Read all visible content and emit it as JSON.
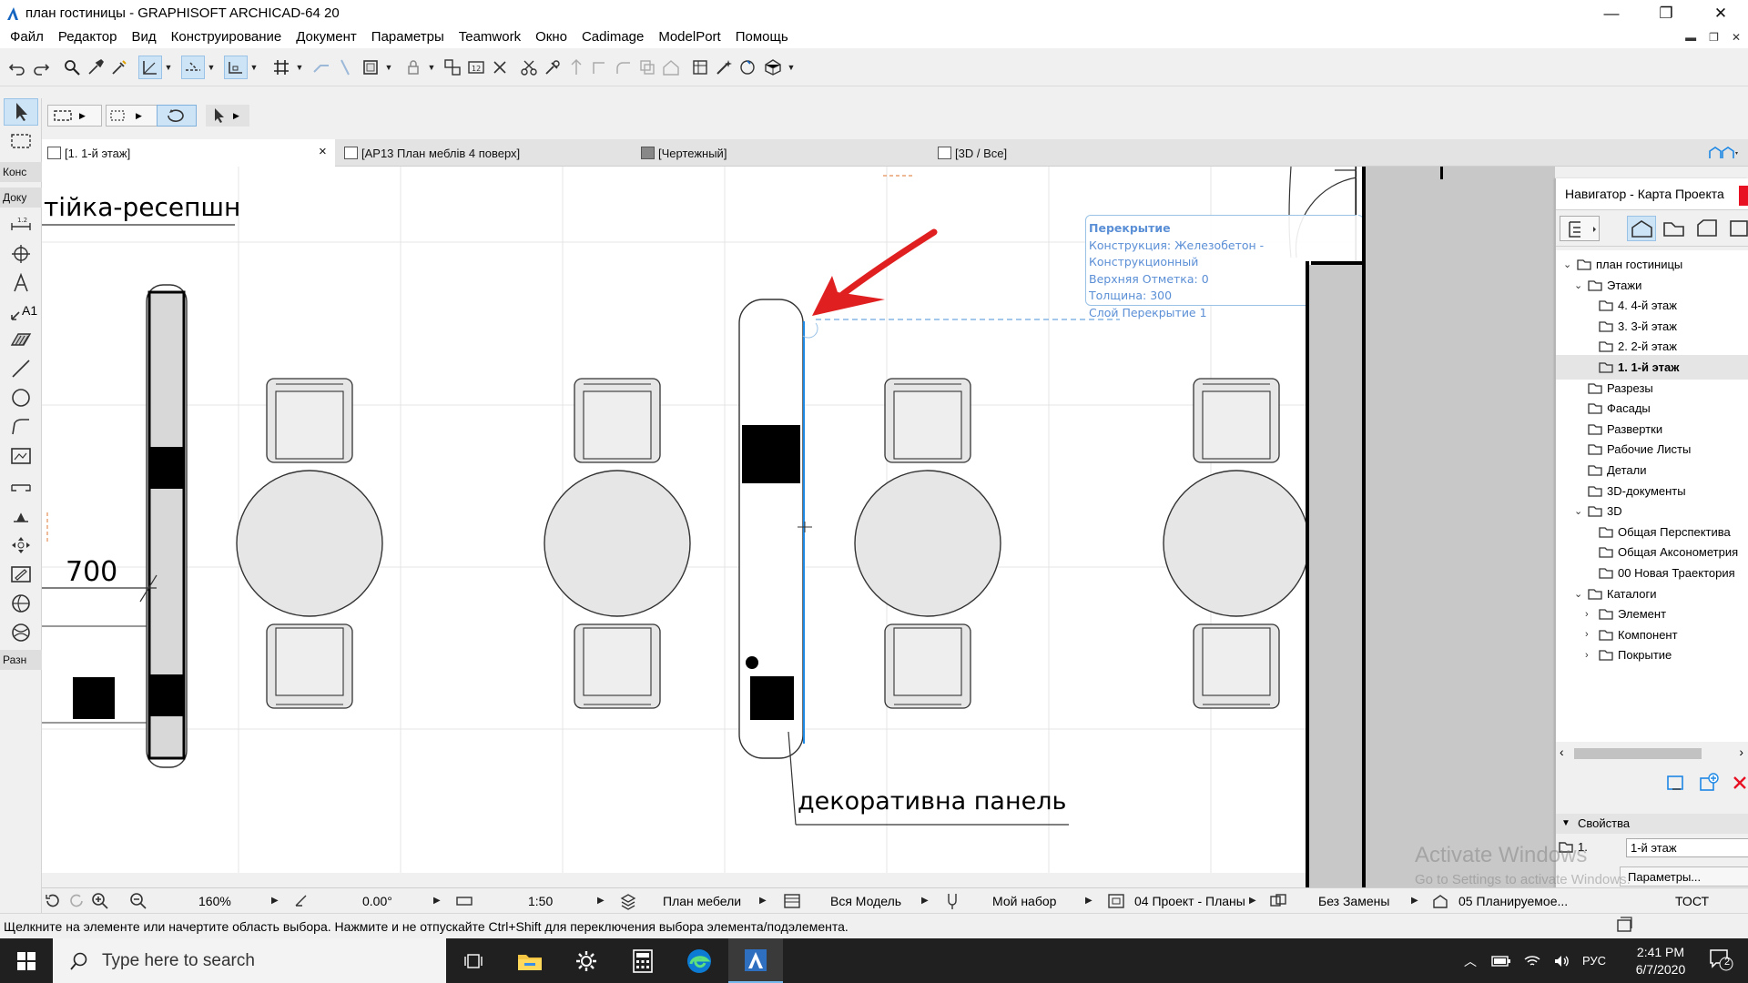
{
  "window": {
    "title": "план гостиницы - GRAPHISOFT ARCHICAD-64 20",
    "minimize": "—",
    "maximize": "❐",
    "close": "✕"
  },
  "menu": {
    "items": [
      "Файл",
      "Редактор",
      "Вид",
      "Конструирование",
      "Документ",
      "Параметры",
      "Teamwork",
      "Окно",
      "Cadimage",
      "ModelPort",
      "Помощь"
    ]
  },
  "toolbox": {
    "section_construct": "Конс",
    "section_document": "Доку",
    "section_more": "Разн",
    "label_tool_text": "A1"
  },
  "tabs": [
    {
      "label": "[1. 1-й этаж]",
      "close": "×"
    },
    {
      "label": "[АР13 План меблів 4 поверх]"
    },
    {
      "label": "[Чертежный]"
    },
    {
      "label": "[3D / Все]"
    }
  ],
  "drawing": {
    "room_label": "тійка-ресепшн",
    "dimension": "700",
    "panel_label": "декоративна панель",
    "tooltip": {
      "title": "Перекрытие",
      "construction": "Конструкция: Железобетон - Конструкционный",
      "top_level": "Верхняя Отметка: 0",
      "thickness": "Толщина: 300",
      "layer": "Слой Перекрытие 1"
    }
  },
  "navigator": {
    "title": "Навигатор - Карта Проекта",
    "tree": [
      {
        "label": "план гостиницы",
        "level": 0,
        "arrow": "v"
      },
      {
        "label": "Этажи",
        "level": 1,
        "arrow": "v"
      },
      {
        "label": "4. 4-й этаж",
        "level": 2
      },
      {
        "label": "3. 3-й этаж",
        "level": 2
      },
      {
        "label": "2. 2-й этаж",
        "level": 2
      },
      {
        "label": "1. 1-й этаж",
        "level": 2,
        "selected": true
      },
      {
        "label": "Разрезы",
        "level": 1
      },
      {
        "label": "Фасады",
        "level": 1
      },
      {
        "label": "Развертки",
        "level": 1
      },
      {
        "label": "Рабочие Листы",
        "level": 1
      },
      {
        "label": "Детали",
        "level": 1
      },
      {
        "label": "3D-документы",
        "level": 1
      },
      {
        "label": "3D",
        "level": 1,
        "arrow": "v"
      },
      {
        "label": "Общая Перспектива",
        "level": 2
      },
      {
        "label": "Общая Аксонометрия",
        "level": 2
      },
      {
        "label": "00 Новая Траектория",
        "level": 2
      },
      {
        "label": "Каталоги",
        "level": 1,
        "arrow": "v"
      },
      {
        "label": "Элемент",
        "level": 2,
        "arrow": ">"
      },
      {
        "label": "Компонент",
        "level": 2,
        "arrow": ">"
      },
      {
        "label": "Покрытие",
        "level": 2,
        "arrow": ">"
      }
    ],
    "properties_header": "Свойства",
    "prop_index": "1.",
    "prop_value": "1-й этаж",
    "params_button": "Параметры..."
  },
  "viewbar": {
    "zoom": "160%",
    "angle": "0.00°",
    "scale": "1:50",
    "layer_combo": "План мебели",
    "model_view": "Вся Модель",
    "pen_set": "Мой набор",
    "dim_style": "04 Проект - Планы",
    "override": "Без Замены",
    "renovation": "05 Планируемое...",
    "extra": "ТОСТ"
  },
  "status": {
    "text": "Щелкните на элементе или начертите область выбора. Нажмите и не отпускайте Ctrl+Shift для переключения выбора элемента/подэлемента."
  },
  "watermark": {
    "line1": "Activate Windows",
    "line2": "Go to Settings to activate Windows."
  },
  "taskbar": {
    "search_placeholder": "Type here to search",
    "language": "РУС",
    "time": "2:41 PM",
    "date": "6/7/2020",
    "notifications": "2"
  },
  "colors": {
    "accent_blue": "#1e88e5",
    "arrow_red": "#e02020",
    "selection_tooltip": "#5b8fd6"
  }
}
